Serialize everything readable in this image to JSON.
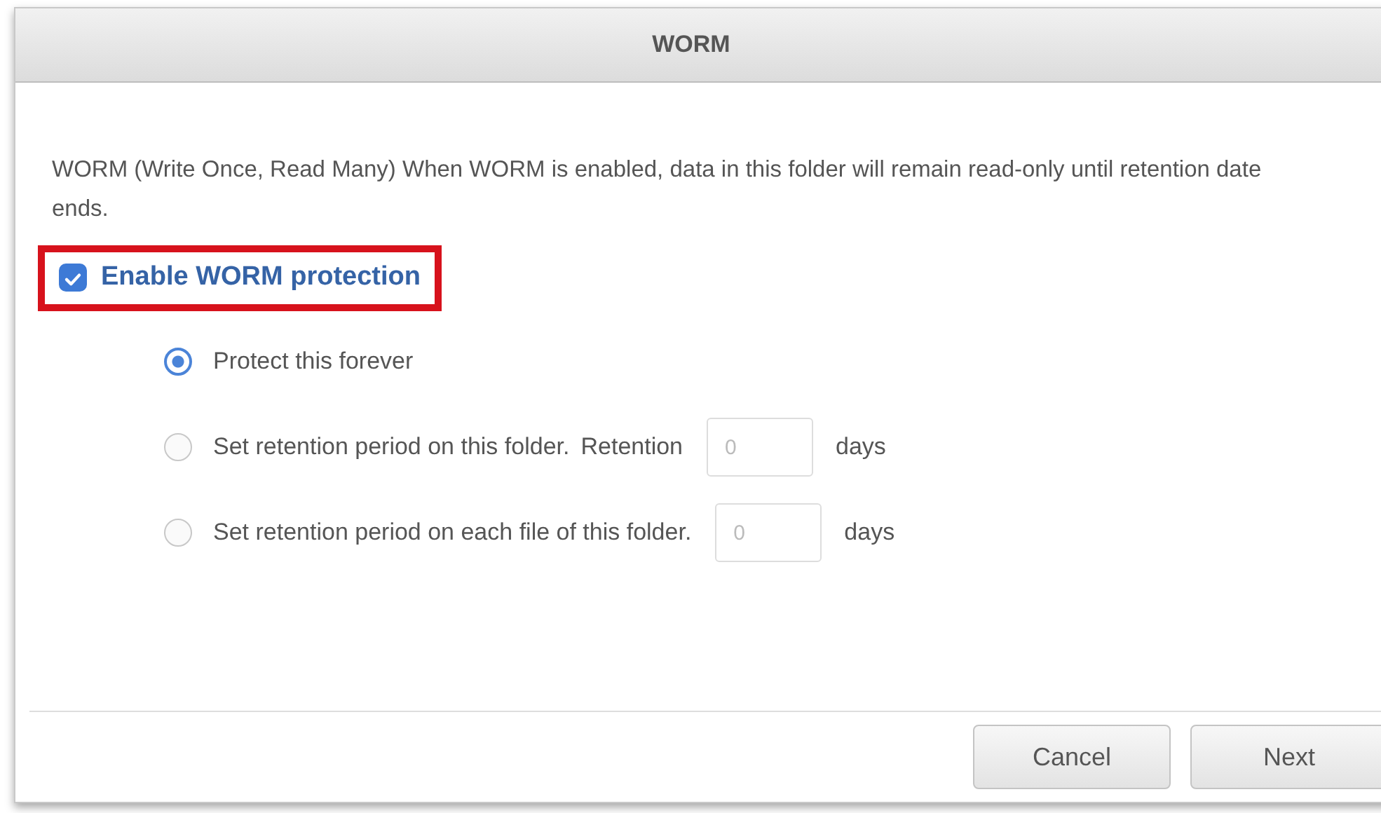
{
  "dialog": {
    "title": "WORM"
  },
  "description": "WORM (Write Once, Read Many) When WORM is enabled, data in this folder will remain read-only until retention date ends.",
  "enable_checkbox": {
    "label": "Enable WORM protection",
    "checked": true,
    "highlighted": true
  },
  "options": [
    {
      "kind": "plain",
      "label": "Protect this forever",
      "selected": true
    },
    {
      "kind": "retention",
      "label": "Set retention period on this folder.",
      "field_label": "Retention",
      "placeholder": "0",
      "unit": "days",
      "selected": false
    },
    {
      "kind": "retention",
      "label": "Set retention period on each file of this folder.",
      "placeholder": "0",
      "unit": "days",
      "selected": false
    }
  ],
  "buttons": [
    "Cancel",
    "Next"
  ]
}
